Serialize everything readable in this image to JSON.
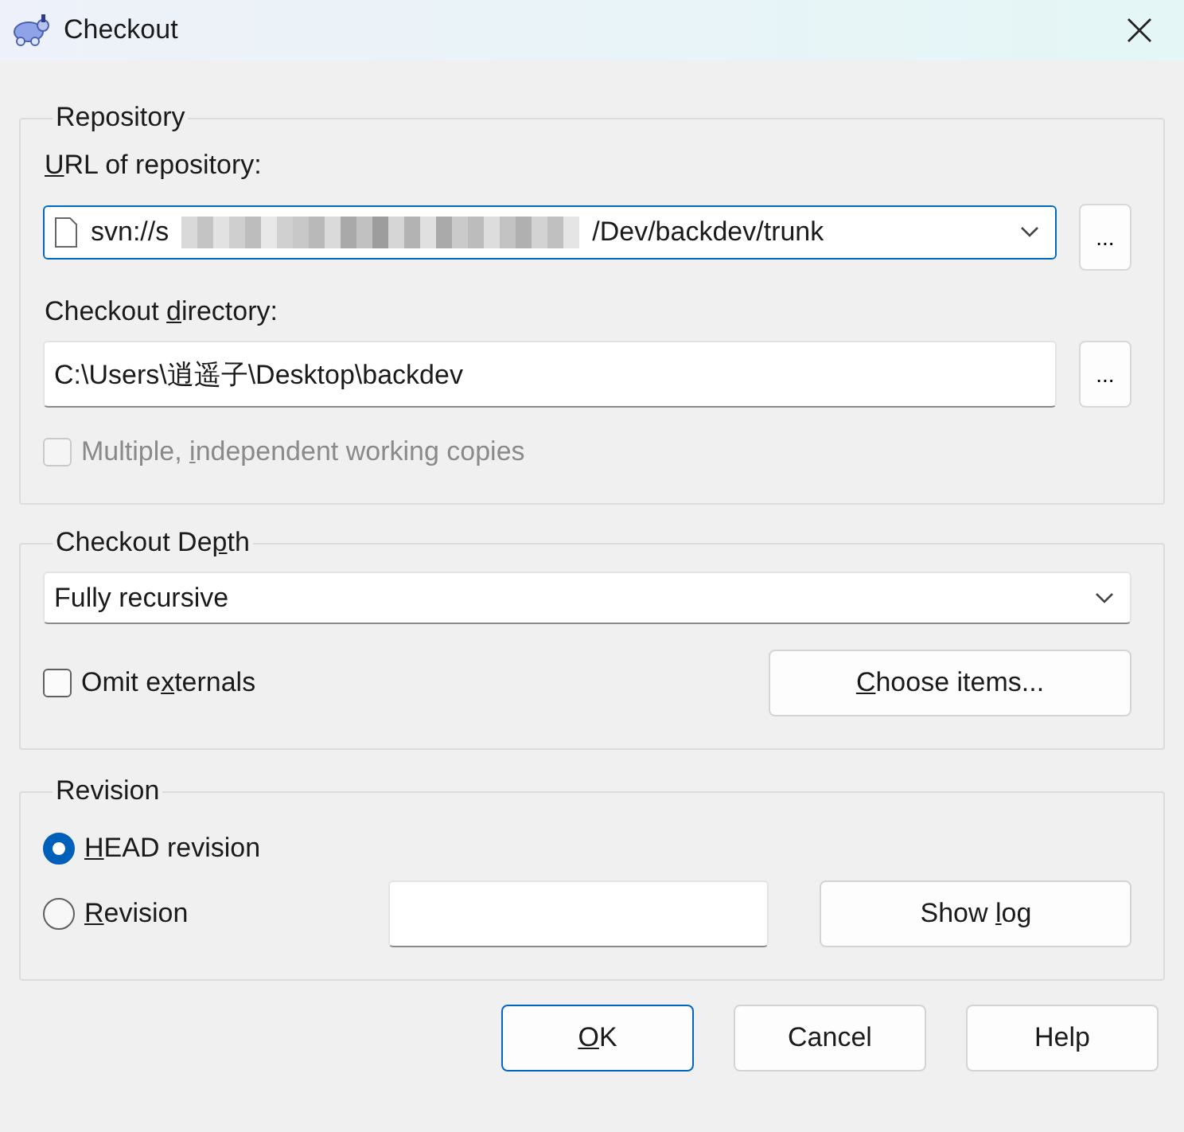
{
  "window": {
    "title": "Checkout"
  },
  "repository": {
    "legend": "Repository",
    "url_label": {
      "key": "U",
      "post": "RL of repository:"
    },
    "url": {
      "value_start": "svn://s",
      "value_end": "/Dev/backdev/trunk",
      "redacted": true,
      "focused": true
    },
    "url_browse": "...",
    "dir_label": {
      "pre": "Checkout ",
      "key": "d",
      "post": "irectory:"
    },
    "dir": {
      "value": "C:\\Users\\逍遥子\\Desktop\\backdev"
    },
    "dir_browse": "...",
    "multiple": {
      "label": {
        "pre": "Multiple, ",
        "key": "i",
        "post": "ndependent working copies"
      },
      "checked": false,
      "disabled": true
    }
  },
  "depth": {
    "legend": {
      "pre": "Checkout De",
      "key": "p",
      "post": "th"
    },
    "select": {
      "value": "Fully recursive"
    },
    "omit": {
      "label": {
        "pre": "Omit e",
        "key": "x",
        "post": "ternals"
      },
      "checked": false,
      "disabled": false
    },
    "choose": {
      "key": "C",
      "post": "hoose items..."
    }
  },
  "revision": {
    "legend": "Revision",
    "options": [
      {
        "label": {
          "key": "H",
          "post": "EAD revision"
        },
        "selected": true
      },
      {
        "label": {
          "key": "R",
          "post": "evision"
        },
        "selected": false
      }
    ],
    "show_log": {
      "pre": "Show ",
      "key": "l",
      "post": "og"
    }
  },
  "buttons": [
    {
      "label": {
        "key": "O",
        "post": "K"
      },
      "default": true
    },
    {
      "label": {
        "pre": "Cancel"
      },
      "default": false
    },
    {
      "label": {
        "pre": "Help"
      },
      "default": false
    }
  ]
}
